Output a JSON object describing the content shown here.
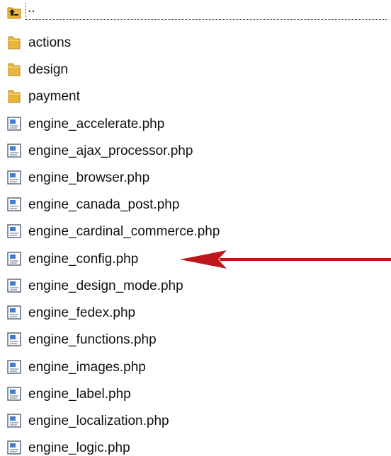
{
  "parent_dir": {
    "label": "..",
    "icon": "up-folder-icon"
  },
  "folders": [
    {
      "label": "actions",
      "icon": "folder-icon"
    },
    {
      "label": "design",
      "icon": "folder-icon"
    },
    {
      "label": "payment",
      "icon": "folder-icon"
    }
  ],
  "files": [
    {
      "label": "engine_accelerate.php",
      "icon": "php-file-icon"
    },
    {
      "label": "engine_ajax_processor.php",
      "icon": "php-file-icon"
    },
    {
      "label": "engine_browser.php",
      "icon": "php-file-icon"
    },
    {
      "label": "engine_canada_post.php",
      "icon": "php-file-icon"
    },
    {
      "label": "engine_cardinal_commerce.php",
      "icon": "php-file-icon"
    },
    {
      "label": "engine_config.php",
      "icon": "php-file-icon"
    },
    {
      "label": "engine_design_mode.php",
      "icon": "php-file-icon"
    },
    {
      "label": "engine_fedex.php",
      "icon": "php-file-icon"
    },
    {
      "label": "engine_functions.php",
      "icon": "php-file-icon"
    },
    {
      "label": "engine_images.php",
      "icon": "php-file-icon"
    },
    {
      "label": "engine_label.php",
      "icon": "php-file-icon"
    },
    {
      "label": "engine_localization.php",
      "icon": "php-file-icon"
    },
    {
      "label": "engine_logic.php",
      "icon": "php-file-icon"
    }
  ],
  "colors": {
    "folder": "#e8b43a",
    "arrow": "#c0161b",
    "file_icon_border": "#5a6b80"
  },
  "highlighted_file": "engine_config.php",
  "annotation": "arrow pointing to engine_config.php"
}
